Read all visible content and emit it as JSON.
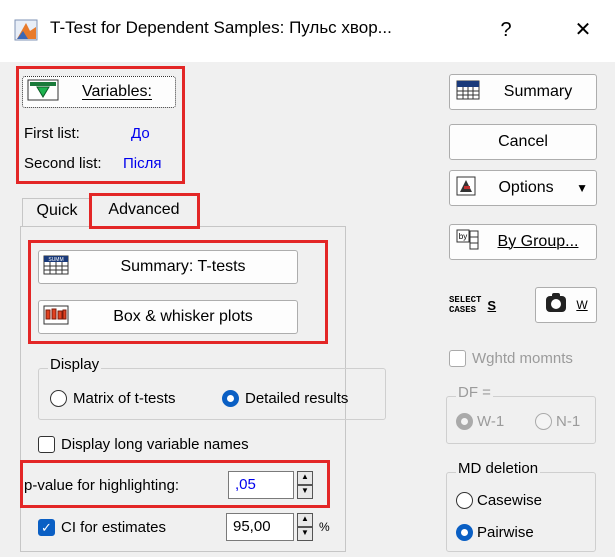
{
  "window": {
    "title": "T-Test for Dependent Samples: Пульс хвор...",
    "help_label": "?",
    "close_label": "✕"
  },
  "variables": {
    "button_label": "Variables:",
    "first_list_label": "First list:",
    "first_list_value": "До",
    "second_list_label": "Second list:",
    "second_list_value": "Після"
  },
  "tabs": [
    {
      "label": "Quick",
      "active": false
    },
    {
      "label": "Advanced",
      "active": true
    }
  ],
  "advanced": {
    "summary_ttests_label": "Summary:  T-tests",
    "box_whisker_label": "Box & whisker plots",
    "display_group_label": "Display",
    "matrix_label": "Matrix of t-tests",
    "matrix_selected": false,
    "detailed_label": "Detailed results",
    "detailed_selected": true,
    "long_names_label": "Display long variable names",
    "long_names_checked": false,
    "pvalue_label": "p-value for highlighting:",
    "pvalue_value": ",05",
    "ci_label": "CI for estimates",
    "ci_checked": true,
    "ci_value": "95,00",
    "ci_unit": "%"
  },
  "sidebar": {
    "summary_label": "Summary",
    "cancel_label": "Cancel",
    "options_label": "Options",
    "by_group_label": "By Group...",
    "select_cases_icon_text": "SELECT\nCASES",
    "select_cases_label": "S",
    "weight_label": "W",
    "wghtd_label": "Wghtd momnts",
    "wghtd_checked": false,
    "df_group_label": "DF =",
    "df_w1_label": "W-1",
    "df_n1_label": "N-1",
    "df_w1_selected": true,
    "md_group_label": "MD deletion",
    "casewise_label": "Casewise",
    "pairwise_label": "Pairwise",
    "pairwise_selected": true
  },
  "colors": {
    "highlight_border": "#e32626",
    "accent": "#0a5fc4",
    "link_blue": "#0000ee"
  }
}
